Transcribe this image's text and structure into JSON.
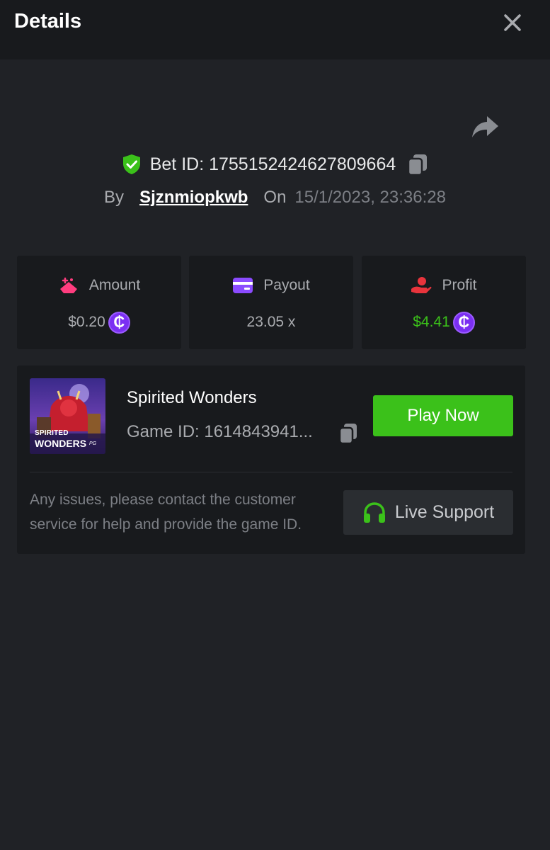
{
  "header": {
    "title": "Details",
    "close_icon": "close-icon"
  },
  "bet": {
    "id_text": "Bet ID: 1755152424627809664",
    "by_label": "By",
    "username": "Sjznmiopkwb",
    "on_label": "On",
    "datetime": "15/1/2023, 23:36:28",
    "verified_icon": "shield-check-icon",
    "copy_icon": "copy-icon",
    "share_icon": "share-icon"
  },
  "stats": [
    {
      "label": "Amount",
      "value": "$0.20",
      "icon": "amount-icon",
      "coin": "₵"
    },
    {
      "label": "Payout",
      "value": "23.05 x",
      "icon": "credit-card-icon"
    },
    {
      "label": "Profit",
      "value": "$4.41",
      "icon": "profit-hand-icon",
      "coin": "₵"
    }
  ],
  "game": {
    "thumb_line1": "SPIRITED",
    "thumb_line2": "WONDERS",
    "thumb_brand": "PG",
    "name": "Spirited Wonders",
    "id_text": "Game ID: 1614843941...",
    "play_label": "Play Now"
  },
  "support": {
    "help_text": "Any issues, please contact the customer service for help and provide the game ID.",
    "button_label": "Live Support",
    "icon": "headset-icon"
  },
  "colors": {
    "background": "#202226",
    "panel": "#181a1d",
    "accent_green": "#3bc11a",
    "coin_purple": "#7b2ff2",
    "amount_pink": "#ff3d7f",
    "payout_purple": "#8b4bff",
    "profit_red": "#e8343c"
  }
}
